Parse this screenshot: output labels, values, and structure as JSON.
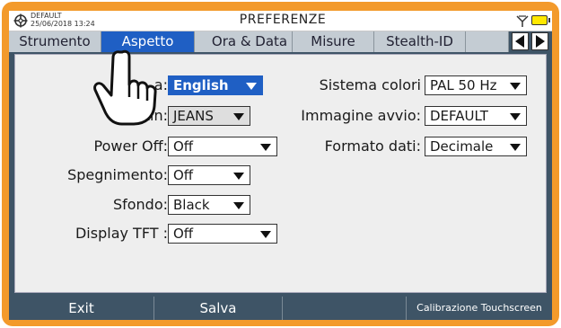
{
  "status": {
    "line1": "DEFAULT",
    "line2": "25/06/2018 13:24",
    "title": "PREFERENZE",
    "icons": [
      "gear-icon",
      "antenna-icon",
      "battery-icon"
    ]
  },
  "tabs": [
    {
      "label": "Strumento"
    },
    {
      "label": "Aspetto",
      "active": true
    },
    {
      "label": "Ora & Data"
    },
    {
      "label": "Misure"
    },
    {
      "label": "Stealth-ID"
    }
  ],
  "tab_arrows": [
    "arrow-left-icon",
    "arrow-right-icon"
  ],
  "settings": {
    "lingua": {
      "label_visible": "a:",
      "value": "English"
    },
    "skin": {
      "label": "Skin:",
      "value": "JEANS"
    },
    "power_off": {
      "label": "Power Off:",
      "value": "Off"
    },
    "spegnimento": {
      "label": "Spegnimento:",
      "value": "Off"
    },
    "sfondo": {
      "label": "Sfondo:",
      "value": "Black"
    },
    "display_tft": {
      "label": "Display TFT :",
      "value": "Off"
    },
    "sistema_colori": {
      "label": "Sistema colori",
      "value": "PAL 50 Hz"
    },
    "immagine_avvio": {
      "label": "Immagine avvio:",
      "value": "DEFAULT"
    },
    "formato_dati": {
      "label": "Formato dati:",
      "value": "Decimale"
    }
  },
  "footer": {
    "exit": "Exit",
    "salva": "Salva",
    "empty": "",
    "calibrazione": "Calibrazione Touchscreen"
  },
  "colors": {
    "frame": "#f39a2b",
    "active_tab": "#1f5fc4",
    "bar": "#3e5466"
  }
}
